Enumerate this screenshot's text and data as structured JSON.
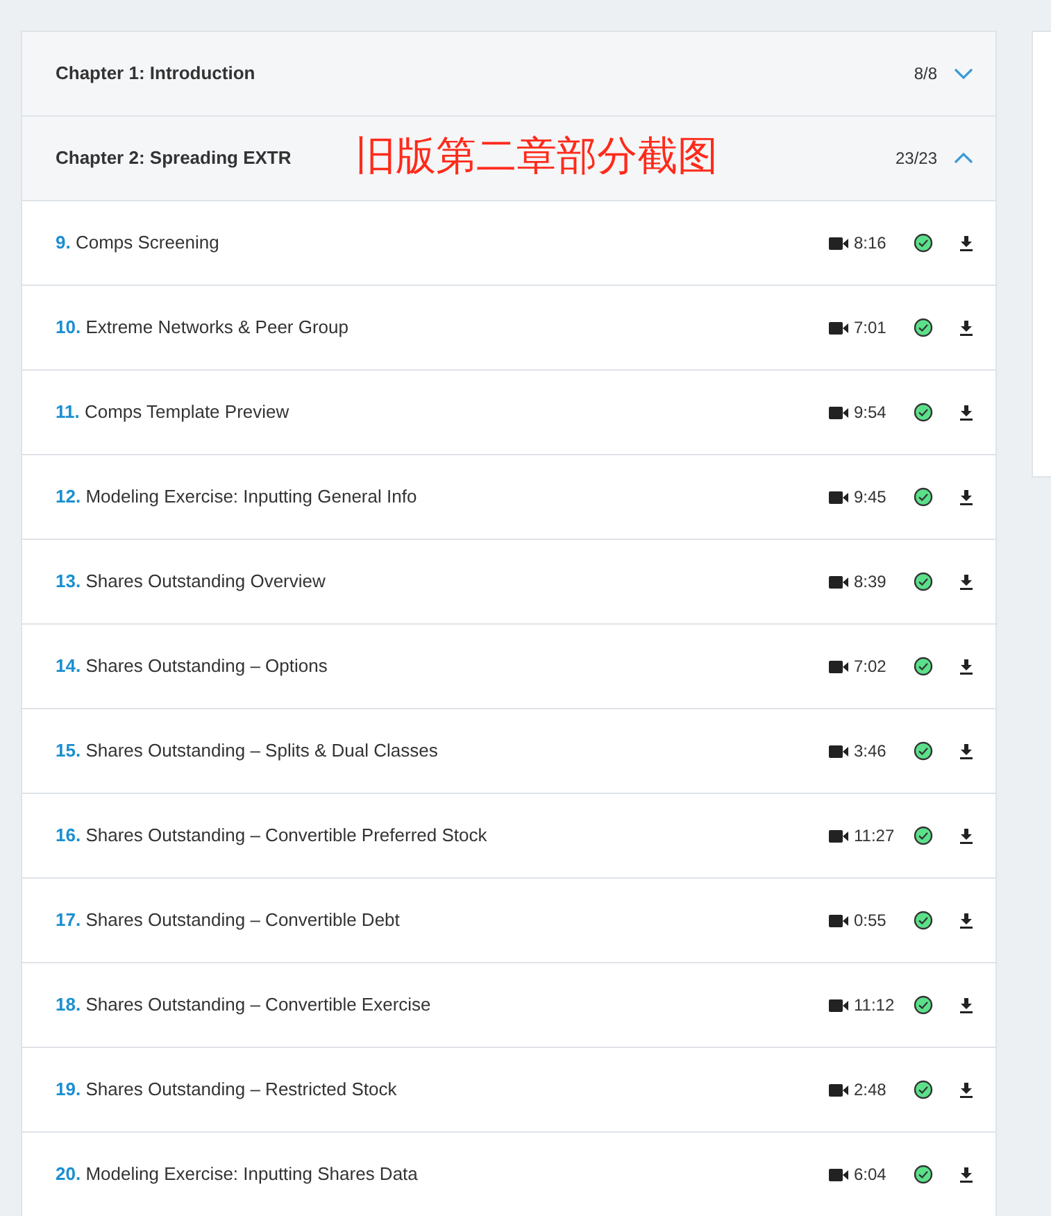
{
  "chapters": [
    {
      "title": "Chapter 1: Introduction",
      "progress": "8/8",
      "expanded": false
    },
    {
      "title": "Chapter 2: Spreading EXTR",
      "progress": "23/23",
      "expanded": true
    }
  ],
  "annotation": "旧版第二章部分截图",
  "lessons": [
    {
      "number": "9.",
      "title": "Comps Screening",
      "duration": "8:16",
      "completed": true
    },
    {
      "number": "10.",
      "title": "Extreme Networks & Peer Group",
      "duration": "7:01",
      "completed": true
    },
    {
      "number": "11.",
      "title": "Comps Template Preview",
      "duration": "9:54",
      "completed": true
    },
    {
      "number": "12.",
      "title": "Modeling Exercise: Inputting General Info",
      "duration": "9:45",
      "completed": true
    },
    {
      "number": "13.",
      "title": "Shares Outstanding Overview",
      "duration": "8:39",
      "completed": true
    },
    {
      "number": "14.",
      "title": "Shares Outstanding – Options",
      "duration": "7:02",
      "completed": true
    },
    {
      "number": "15.",
      "title": "Shares Outstanding – Splits & Dual Classes",
      "duration": "3:46",
      "completed": true
    },
    {
      "number": "16.",
      "title": "Shares Outstanding – Convertible Preferred Stock",
      "duration": "11:27",
      "completed": true
    },
    {
      "number": "17.",
      "title": "Shares Outstanding – Convertible Debt",
      "duration": "0:55",
      "completed": true
    },
    {
      "number": "18.",
      "title": "Shares Outstanding – Convertible Exercise",
      "duration": "11:12",
      "completed": true
    },
    {
      "number": "19.",
      "title": "Shares Outstanding – Restricted Stock",
      "duration": "2:48",
      "completed": true
    },
    {
      "number": "20.",
      "title": "Modeling Exercise: Inputting Shares Data",
      "duration": "6:04",
      "completed": true
    }
  ]
}
